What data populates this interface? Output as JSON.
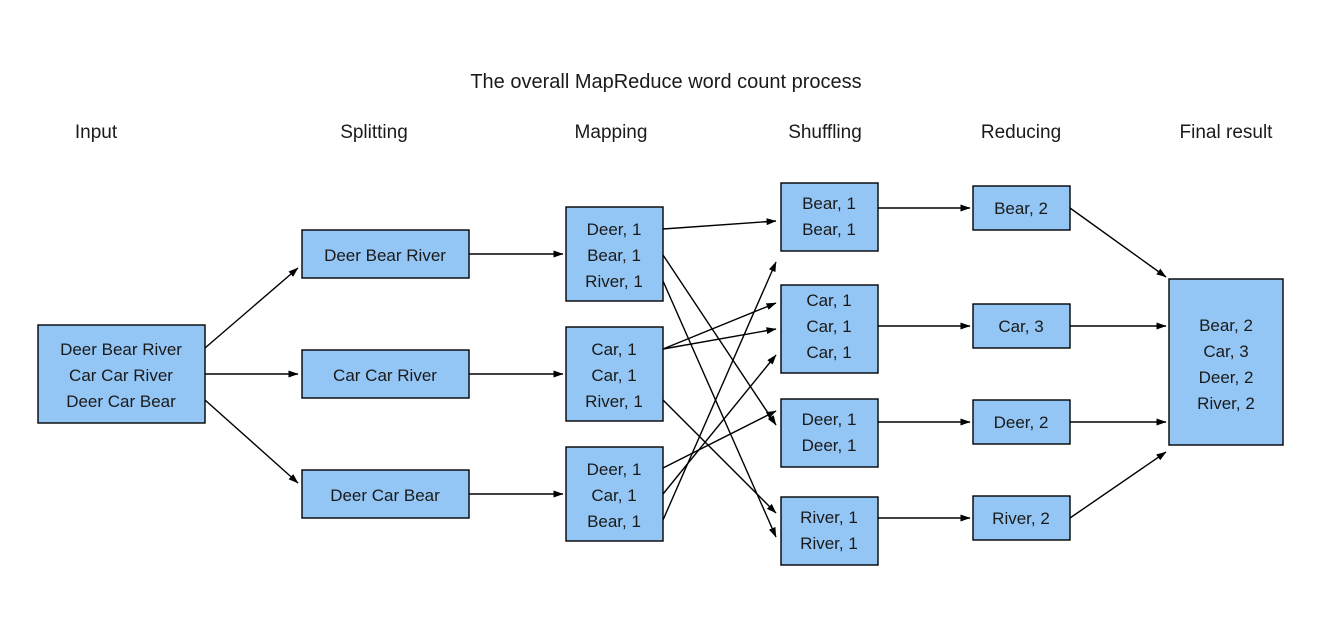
{
  "title": "The overall MapReduce word count process",
  "headers": [
    {
      "label": "Input"
    },
    {
      "label": "Splitting"
    },
    {
      "label": "Mapping"
    },
    {
      "label": "Shuffling"
    },
    {
      "label": "Reducing"
    },
    {
      "label": "Final result"
    }
  ],
  "colors": {
    "box_fill": "#93c6f5",
    "box_stroke": "#000000",
    "text": "#1a1a1a",
    "background": "#ffffff"
  },
  "input": {
    "lines": [
      "Deer Bear River",
      "Car Car River",
      "Deer Car Bear"
    ]
  },
  "splitting": [
    {
      "lines": [
        "Deer Bear River"
      ]
    },
    {
      "lines": [
        "Car Car River"
      ]
    },
    {
      "lines": [
        "Deer Car Bear"
      ]
    }
  ],
  "mapping": [
    {
      "lines": [
        "Deer, 1",
        "Bear, 1",
        "River, 1"
      ]
    },
    {
      "lines": [
        "Car, 1",
        "Car, 1",
        "River, 1"
      ]
    },
    {
      "lines": [
        "Deer, 1",
        "Car, 1",
        "Bear, 1"
      ]
    }
  ],
  "shuffling": [
    {
      "lines": [
        "Bear, 1",
        "Bear, 1"
      ]
    },
    {
      "lines": [
        "Car, 1",
        "Car, 1",
        "Car, 1"
      ]
    },
    {
      "lines": [
        "Deer, 1",
        "Deer, 1"
      ]
    },
    {
      "lines": [
        "River, 1",
        "River, 1"
      ]
    }
  ],
  "reducing": [
    {
      "lines": [
        "Bear, 2"
      ]
    },
    {
      "lines": [
        "Car, 3"
      ]
    },
    {
      "lines": [
        "Deer, 2"
      ]
    },
    {
      "lines": [
        "River, 2"
      ]
    }
  ],
  "final_result": {
    "lines": [
      "Bear, 2",
      "Car, 3",
      "Deer, 2",
      "River, 2"
    ]
  }
}
